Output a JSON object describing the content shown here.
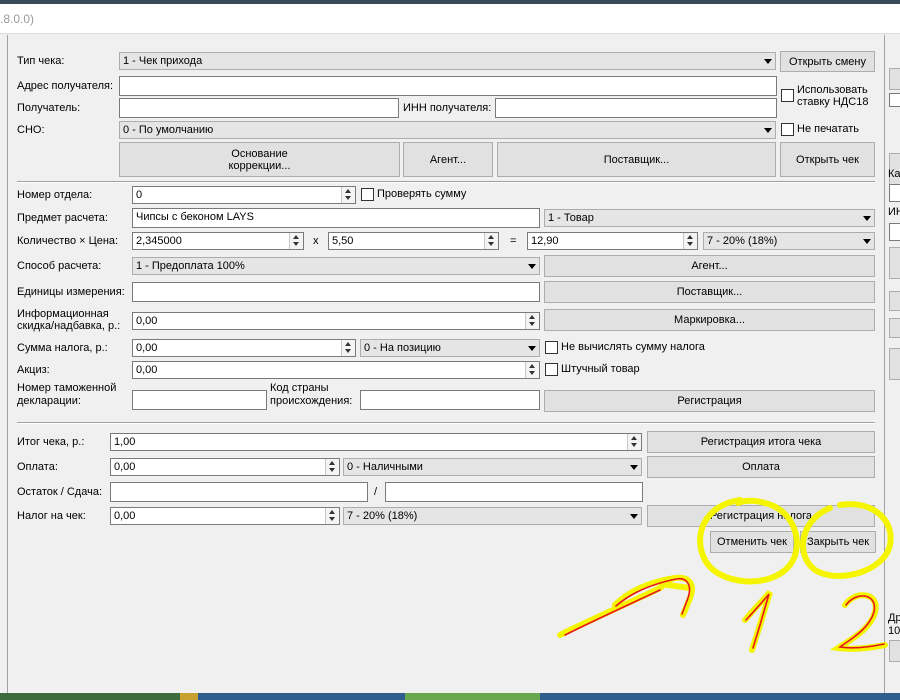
{
  "window": {
    "title_fragment": ".8.0.0)"
  },
  "header": {
    "receipt_type_label": "Тип чека:",
    "receipt_type_value": "1 - Чек прихода",
    "open_shift": "Открыть смену",
    "recipient_address_label": "Адрес получателя:",
    "recipient_label": "Получатель:",
    "recipient_inn_label": "ИНН получателя:",
    "vat18_label": "Использовать ставку НДС18",
    "sno_label": "СНО:",
    "sno_value": "0 - По умолчанию",
    "no_print_label": "Не печатать",
    "correction_basis": "Основание коррекции...",
    "agent": "Агент...",
    "supplier": "Поставщик...",
    "open_receipt": "Открыть чек"
  },
  "position": {
    "department_label": "Номер отдела:",
    "department_value": "0",
    "check_sum_label": "Проверять сумму",
    "subject_label": "Предмет расчета:",
    "subject_value": "Чипсы с беконом LAYS",
    "subject_type": "1 - Товар",
    "qty_price_label": "Количество × Цена:",
    "qty_value": "2,345000",
    "times": "x",
    "price_value": "5,50",
    "equals": "=",
    "total_value": "12,90",
    "tax_rate": "7 - 20% (18%)",
    "payment_method_label": "Способ расчета:",
    "payment_method_value": "1 - Предоплата 100%",
    "agent": "Агент...",
    "units_label": "Единицы измерения:",
    "supplier": "Поставщик...",
    "discount_label_1": "Информационная",
    "discount_label_2": "скидка/надбавка, р.:",
    "discount_value": "0,00",
    "marking": "Маркировка...",
    "tax_sum_label": "Сумма налога, р.:",
    "tax_sum_value": "0,00",
    "tax_mode": "0 - На позицию",
    "no_calc_tax_label": "Не вычислять сумму налога",
    "excise_label": "Акциз:",
    "excise_value": "0,00",
    "piece_label": "Штучный товар",
    "customs_label_1": "Номер таможенной",
    "customs_label_2": "декларации:",
    "country_label_1": "Код страны",
    "country_label_2": "происхождения:",
    "register": "Регистрация"
  },
  "totals": {
    "receipt_total_label": "Итог чека, р.:",
    "receipt_total_value": "1,00",
    "register_total": "Регистрация итога чека",
    "payment_label": "Оплата:",
    "payment_value": "0,00",
    "payment_type": "0 - Наличными",
    "payment_button": "Оплата",
    "change_label": "Остаток / Сдача:",
    "slash": "/",
    "tax_label": "Налог на чек:",
    "tax_value": "0,00",
    "tax_rate": "7 - 20% (18%)",
    "register_tax": "Регистрация налога",
    "cancel_receipt": "Отменить чек",
    "close_receipt": "Закрыть чек"
  },
  "right_panel": {
    "frag1": "Ка",
    "frag2": "ИН",
    "frag3": "Др",
    "frag4": "10"
  },
  "annotation": {
    "n1": "1",
    "n2": "2",
    "color": "#f5f500",
    "ink": "#e8161b"
  }
}
